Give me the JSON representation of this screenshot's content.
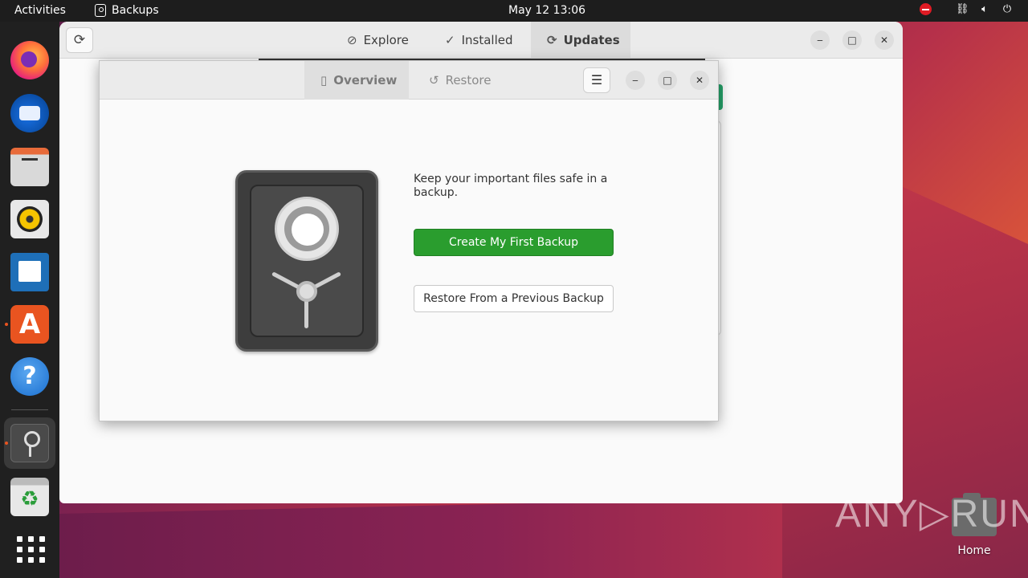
{
  "topbar": {
    "activities": "Activities",
    "app_name": "Backups",
    "clock": "May 12  13:06"
  },
  "software": {
    "tabs": [
      {
        "label": "Explore",
        "icon": "compass-icon"
      },
      {
        "label": "Installed",
        "icon": "check-circle-icon"
      },
      {
        "label": "Updates",
        "icon": "sync-icon",
        "active": true
      }
    ]
  },
  "backups": {
    "tabs": [
      {
        "label": "Overview",
        "icon": "safe-icon",
        "active": true
      },
      {
        "label": "Restore",
        "icon": "history-icon"
      }
    ],
    "message": "Keep your important files safe in a backup.",
    "create_label": "Create My First Backup",
    "restore_label": "Restore From a Previous Backup"
  },
  "desktop": {
    "home_label": "Home"
  },
  "watermark": "ANY▷RUN",
  "colors": {
    "primary_button": "#2a9d2e",
    "ubuntu_orange": "#e95420",
    "topbar": "#1d1d1d"
  }
}
